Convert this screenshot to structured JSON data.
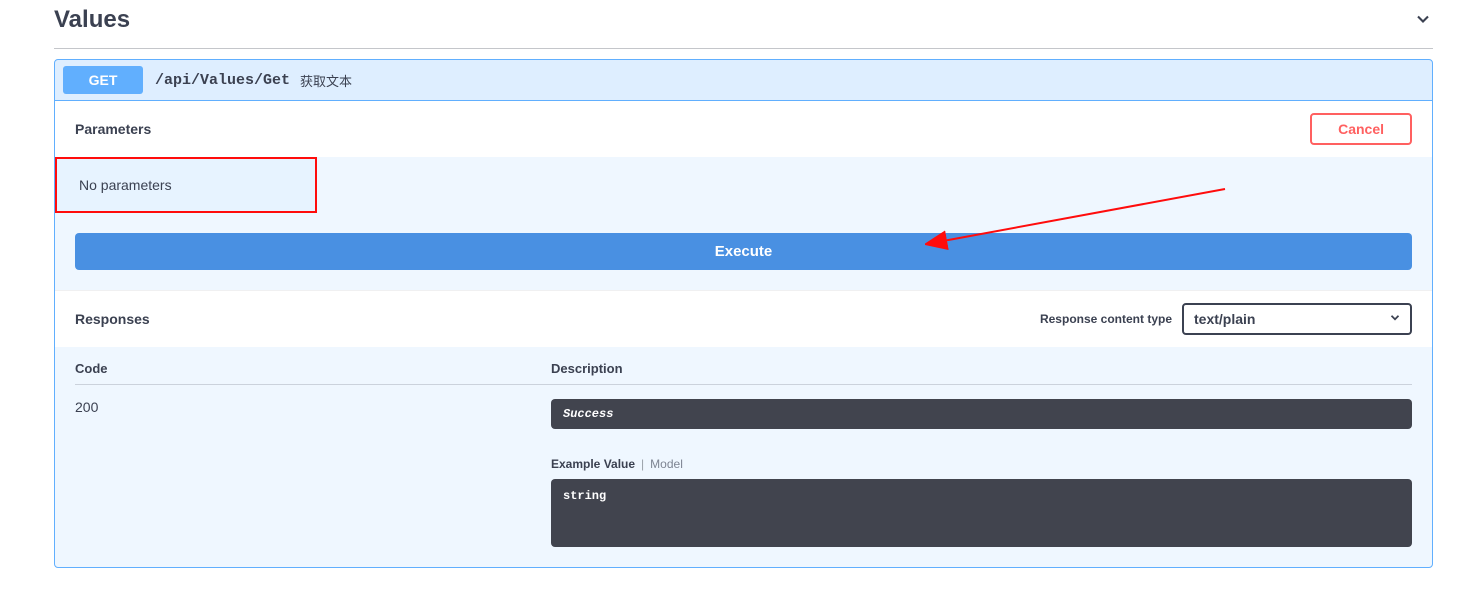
{
  "tag": {
    "title": "Values"
  },
  "operation": {
    "method": "GET",
    "path": "/api/Values/Get",
    "summary": "获取文本"
  },
  "parameters": {
    "header_label": "Parameters",
    "cancel_label": "Cancel",
    "empty_text": "No parameters"
  },
  "execute": {
    "label": "Execute"
  },
  "responses": {
    "header_label": "Responses",
    "content_type_label": "Response content type",
    "content_type_selected": "text/plain",
    "columns": {
      "code": "Code",
      "description": "Description"
    },
    "rows": [
      {
        "code": "200",
        "description_text": "Success",
        "tabs": {
          "active": "Example Value",
          "inactive": "Model"
        },
        "example_body": "string"
      }
    ]
  }
}
